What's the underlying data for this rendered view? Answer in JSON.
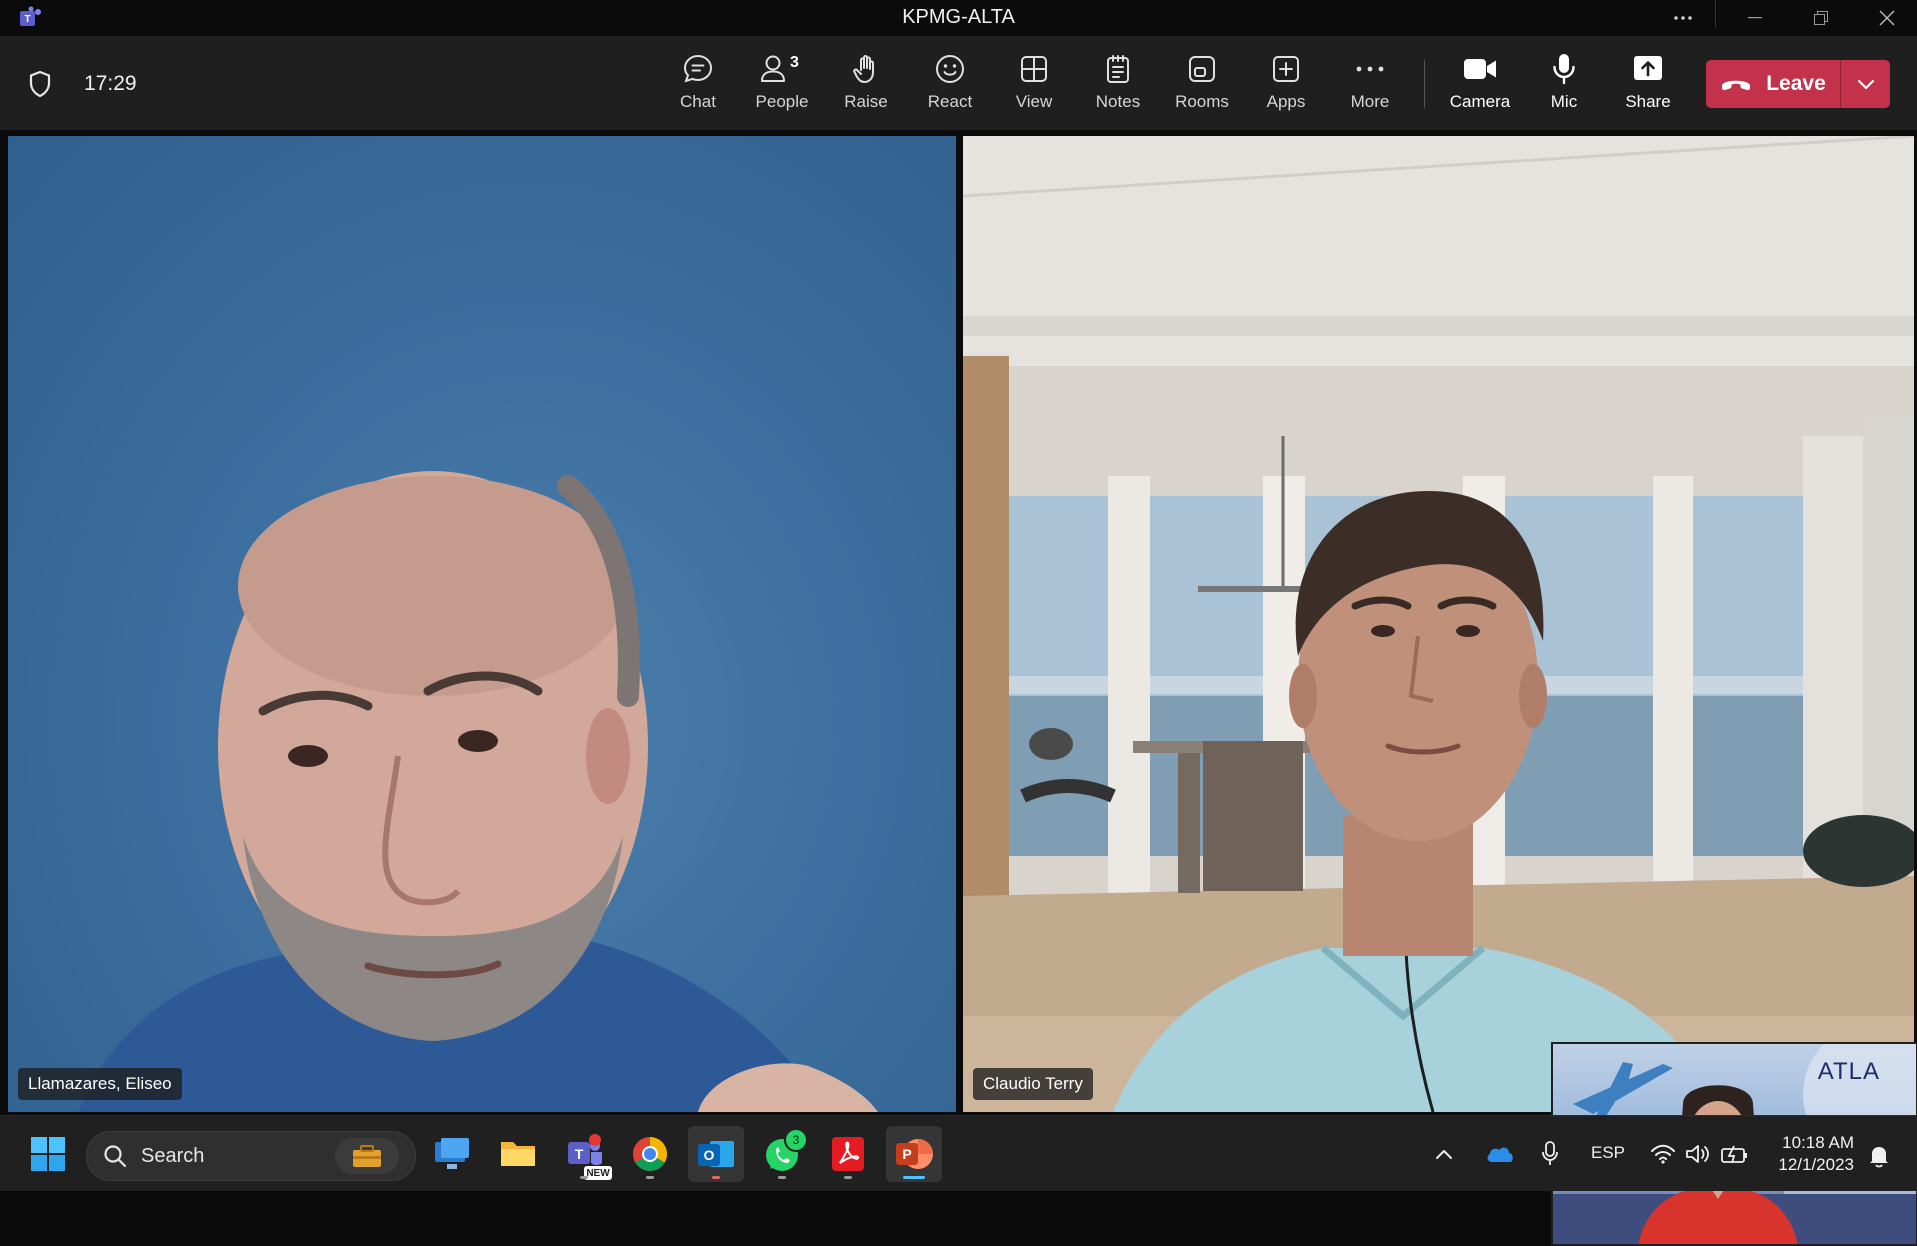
{
  "window": {
    "title": "KPMG-ALTA"
  },
  "meeting": {
    "timer": "17:29",
    "toolbar": {
      "chat": "Chat",
      "people": "People",
      "people_count": "3",
      "raise": "Raise",
      "react": "React",
      "view": "View",
      "notes": "Notes",
      "rooms": "Rooms",
      "apps": "Apps",
      "more": "More",
      "camera": "Camera",
      "mic": "Mic",
      "share": "Share",
      "leave": "Leave"
    },
    "participants": [
      {
        "name": "Llamazares, Eliseo"
      },
      {
        "name": "Claudio Terry"
      }
    ],
    "self_view_brand": "ATLA"
  },
  "taskbar": {
    "search_label": "Search",
    "whatsapp_badge": "3",
    "teams_badge_text": "NEW",
    "language": "ESP",
    "time": "10:18 AM",
    "date": "12/1/2023"
  },
  "colors": {
    "leave": "#c4314b",
    "toolbar_bg": "#1f1f1f",
    "accent": "#4cc2ff"
  }
}
